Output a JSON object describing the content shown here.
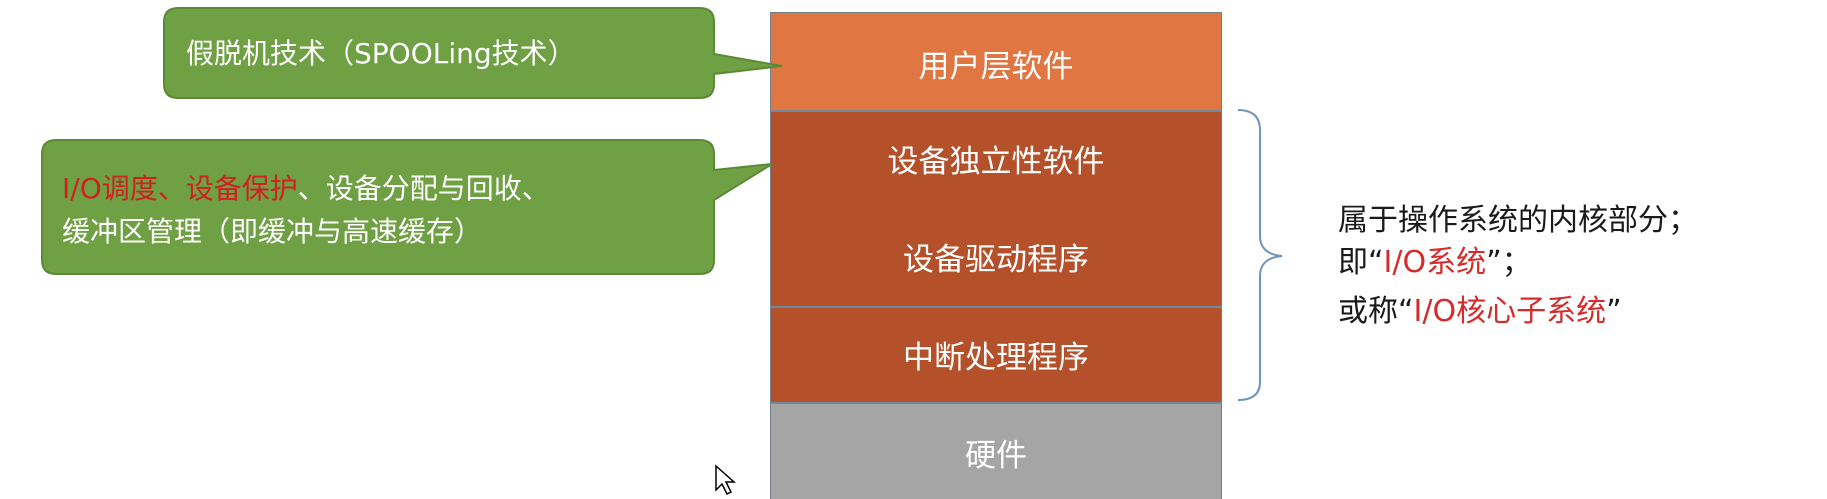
{
  "layers": {
    "user": "用户层软件",
    "device_independent": "设备独立性软件",
    "device_driver": "设备驱动程序",
    "interrupt": "中断处理程序",
    "hardware": "硬件"
  },
  "callout_top": {
    "text": "假脱机技术（SPOOLing技术）"
  },
  "callout_middle": {
    "red_part1": "I/O调度",
    "sep1": "、",
    "red_part2": "设备保护",
    "rest_line1": "、设备分配与回收、",
    "line2": "缓冲区管理（即缓冲与高速缓存）"
  },
  "annotation": {
    "line1": "属于操作系统的内核部分；",
    "line2_prefix": "即“",
    "line2_red": "I/O系统",
    "line2_suffix": "”；",
    "line3_prefix": "或称“",
    "line3_red": "I/O核心子系统",
    "line3_suffix": "”"
  },
  "colors": {
    "user_layer": "#e07641",
    "kernel_layers": "#b5512a",
    "hardware_layer": "#a5a5a5",
    "callout_fill": "#70a044",
    "highlight_red": "#d02020"
  }
}
